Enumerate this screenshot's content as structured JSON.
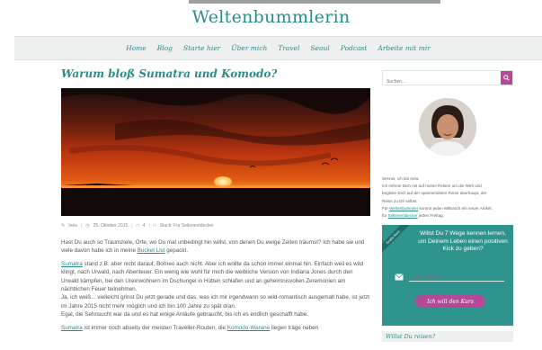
{
  "site": {
    "title": "Weltenbummlerin"
  },
  "nav": {
    "items": [
      "Home",
      "Blog",
      "Starte hier",
      "Über mich",
      "Travel",
      "Seoul",
      "Podcast",
      "Arbeite mit mir"
    ]
  },
  "post": {
    "title": "Warum bloß Sumatra und Komodo?",
    "meta": {
      "author": "Inéa",
      "date": "25. Oktober 2015",
      "comments": "4",
      "category": "Stuck: Für Seilenentdecker"
    },
    "intro_1": "Hast Du auch so Traumziele, Orte, wo Du mal unbedingt hin willst, von denen Du ewige Zeiten träumst? Ich habe sie und viele davon habe ich in meine ",
    "intro_link": "Bucket List",
    "intro_2": " gepackt.",
    "p2_link": "Sumatra",
    "p2_text": " stand z.B. aber nicht darauf, Borneo auch nicht. Aber ich wollte da schon immer einmal hin. Einfach weil es wild klingt, nach Urwald, nach Abenteuer. Ein wenig wie wohl für mich die weibliche Version von Indiana Jones durch den Urwald kämpfen, bei den Ureinwohnern im Dschungel in Hütten schlafen und an geheimnisvollen Zeremonien am nächtlichen Feuer teilnehmen.",
    "p3": "Ja, ich weiß... vielleicht grinst Du jetzt gerade und das, was ich mir irgendwann so wild-romantisch ausgemalt habe, ist jetzt im Jahre 2015 nicht mehr möglich und ich bin 100 Jahre zu spät dran.",
    "p4": "Egal, die Sehnsucht war da und es hat einige Anläufe gebraucht, bis ich es endlich geschafft habe.",
    "p5_link": "Sumatra",
    "p5_text_a": " ist immer noch abseits der meisten Traveller-Routen, die ",
    "p5_link2": "Komodo-Warane",
    "p5_text_b": " liegen träge neben"
  },
  "sidebar": {
    "search_placeholder": "Suchen...",
    "about_1": "Servus, ich bin Inéa.",
    "about_2": "Ich nehme Dich mit auf meine Reisen um die Welt und",
    "about_3": "begleite Dich auf der spannendsten Reise überhaupt, der",
    "about_4": "Reise zu Dir selbst.",
    "about_5a": "Für ",
    "about_5_link": "Weltenbummler",
    "about_5b": " kommt jeden Mittwoch ein neuer Artikel,",
    "about_6a": "für ",
    "about_6_link": "Seilenentdecker",
    "about_6b": " jeden Freitag.",
    "ribbon": "Gratis Kurs",
    "newsletter_headline": "Willst Du 7 Wege kennen lernen, um Deinem Leben einen positiven Kick zu geben?",
    "email_placeholder": "Email-Adresse",
    "cta": "Ich will den Kurs",
    "reisen_title": "Willst Du reisen?"
  },
  "colors": {
    "accent": "#2b8c89",
    "brand_pink": "#b6489a",
    "teal_box": "#2f938e"
  }
}
